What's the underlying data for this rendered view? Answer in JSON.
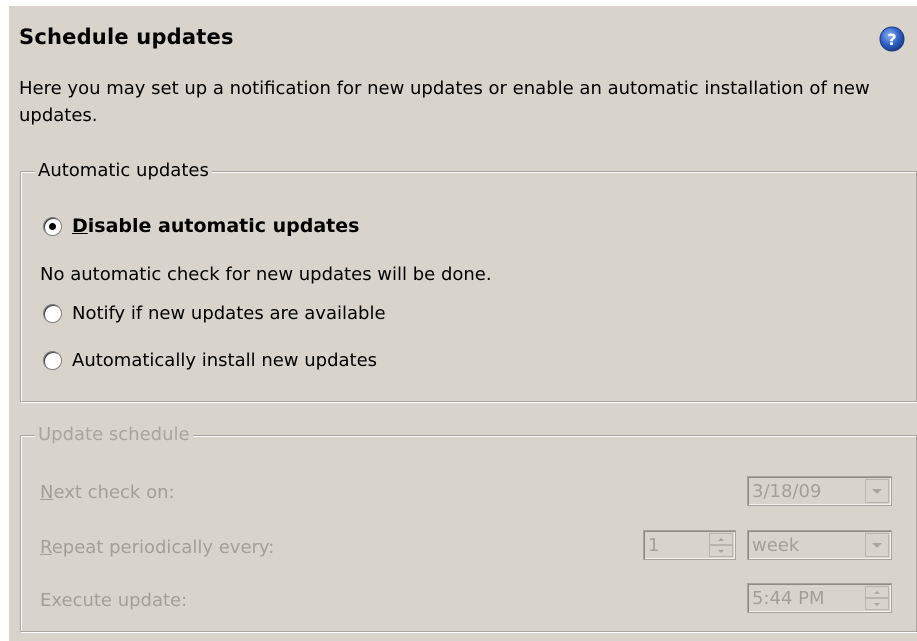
{
  "page": {
    "title": "Schedule updates",
    "description": "Here you may set up a notification for new updates or enable an automatic installation of new updates."
  },
  "automatic_updates": {
    "legend": "Automatic updates",
    "options": [
      {
        "label": "Disable automatic updates",
        "mnemonic": "D",
        "rest": "isable automatic updates",
        "selected": true
      },
      {
        "label": "Notify if new updates are available",
        "selected": false
      },
      {
        "label": "Automatically install new updates",
        "selected": false
      }
    ],
    "note": "No automatic check for new updates will be done."
  },
  "update_schedule": {
    "legend": "Update schedule",
    "next_check_label_mn": "N",
    "next_check_label_rest": "ext check on:",
    "next_check_value": "3/18/09",
    "repeat_label_mn": "R",
    "repeat_label_rest": "epeat periodically every:",
    "repeat_count": "1",
    "repeat_unit": "week",
    "execute_label": "Execute update:",
    "execute_time": "5:44 PM"
  },
  "icons": {
    "help": "help-icon"
  },
  "colors": {
    "panel_bg": "#d8d4cb",
    "disabled_text": "#a39f96",
    "help_blue": "#2f62c8"
  }
}
